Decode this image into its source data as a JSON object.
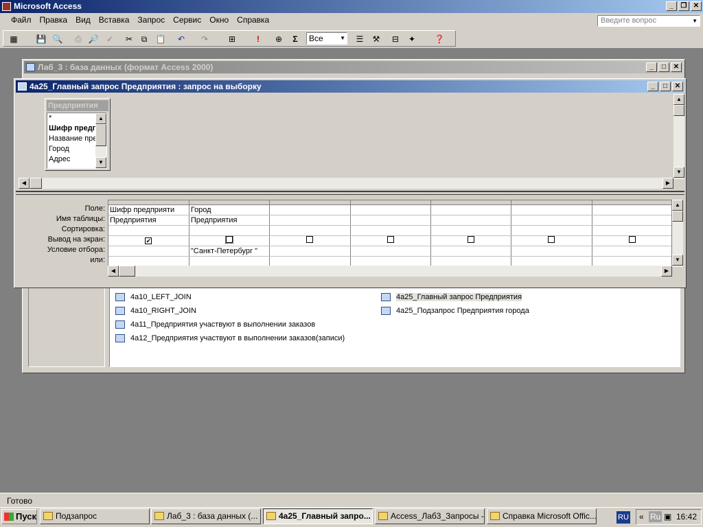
{
  "app": {
    "title": "Microsoft Access",
    "help_box_placeholder": "Введите вопрос"
  },
  "menu": [
    "Файл",
    "Правка",
    "Вид",
    "Вставка",
    "Запрос",
    "Сервис",
    "Окно",
    "Справка"
  ],
  "toolbar": {
    "top_values_select": "Все",
    "sum_label": "Σ",
    "run_label": "!"
  },
  "db_window": {
    "title": "Лаб_3 : база данных (формат Access 2000)",
    "items_left": [
      "4a10_LEFT_JOIN",
      "4a10_RIGHT_JOIN",
      "4a11_Предприятия участвуют в выполнении заказов",
      "4a12_Предприятия участвуют в выполнении заказов(записи)"
    ],
    "items_right": [
      "4a25_Главный запрос Предприятия",
      "4a25_Подзапрос Предприятия города"
    ]
  },
  "query_window": {
    "title": "4a25_Главный запрос Предприятия : запрос на выборку",
    "table": {
      "name": "Предприятия",
      "fields": [
        "*",
        "Шифр предприятия",
        "Название предприятия",
        "Город",
        "Адрес"
      ]
    },
    "grid_labels": [
      "Поле:",
      "Имя таблицы:",
      "Сортировка:",
      "Вывод на экран:",
      "Условие отбора:",
      "или:"
    ],
    "columns": [
      {
        "field": "Шифр предприяти",
        "table": "Предприятия",
        "show": true,
        "criteria": ""
      },
      {
        "field": "Город",
        "table": "Предприятия",
        "show": false,
        "criteria": "\"Санкт-Петербург \""
      },
      {
        "field": "",
        "table": "",
        "show": false,
        "criteria": ""
      },
      {
        "field": "",
        "table": "",
        "show": false,
        "criteria": ""
      },
      {
        "field": "",
        "table": "",
        "show": false,
        "criteria": ""
      },
      {
        "field": "",
        "table": "",
        "show": false,
        "criteria": ""
      },
      {
        "field": "",
        "table": "",
        "show": false,
        "criteria": ""
      }
    ]
  },
  "status": {
    "text": "Готово"
  },
  "taskbar": {
    "start": "Пуск",
    "tasks": [
      "Подзапрос",
      "Лаб_3 : база данных (...",
      "4a25_Главный запро...",
      "Access_Лаб3_Запросы -...",
      "Справка Microsoft Offic..."
    ],
    "lang": "RU",
    "tray_lang": "Ru",
    "time": "16:42"
  }
}
